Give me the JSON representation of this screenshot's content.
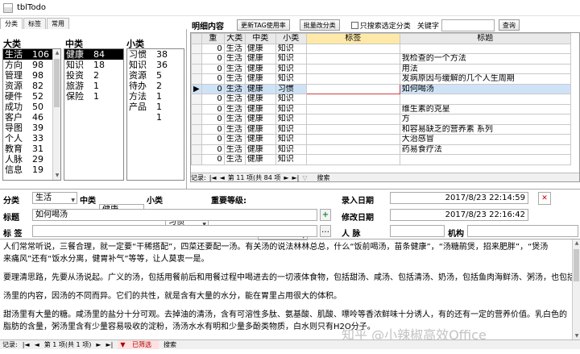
{
  "window": {
    "title": "tblTodo"
  },
  "tabs": [
    "分类",
    "标签",
    "常用"
  ],
  "left_pane": {
    "headers": {
      "big": "大类",
      "mid": "中类",
      "small": "小类"
    },
    "big": [
      {
        "name": "生活",
        "count": "106"
      },
      {
        "name": "方向",
        "count": "98"
      },
      {
        "name": "管理",
        "count": "98"
      },
      {
        "name": "资源",
        "count": "82"
      },
      {
        "name": "硬件",
        "count": "52"
      },
      {
        "name": "成功",
        "count": "50"
      },
      {
        "name": "客户",
        "count": "46"
      },
      {
        "name": "导图",
        "count": "39"
      },
      {
        "name": "个人",
        "count": "33"
      },
      {
        "name": "教育",
        "count": "31"
      },
      {
        "name": "人脉",
        "count": "29"
      },
      {
        "name": "信息",
        "count": "19"
      }
    ],
    "mid": [
      {
        "name": "健康",
        "count": "84"
      },
      {
        "name": "知识",
        "count": "18"
      },
      {
        "name": "投资",
        "count": "2"
      },
      {
        "name": "旅游",
        "count": "1"
      },
      {
        "name": "保险",
        "count": "1"
      }
    ],
    "small": [
      {
        "name": "习惯",
        "count": "38"
      },
      {
        "name": "知识",
        "count": "36"
      },
      {
        "name": "资源",
        "count": "5"
      },
      {
        "name": "待办",
        "count": "2"
      },
      {
        "name": "方法",
        "count": "1"
      },
      {
        "name": "产品",
        "count": "1"
      },
      {
        "name": "",
        "count": "1"
      }
    ]
  },
  "right_pane": {
    "label": "明细内容",
    "btn_update_tag": "更新TAG使用率",
    "btn_batch": "批量改分类",
    "chk_only_selected": "只搜索选定分类",
    "keyword_label": "关键字",
    "btn_search": "查询",
    "columns": [
      "重",
      "大类",
      "中类",
      "小类",
      "标签",
      "标题"
    ],
    "rows": [
      {
        "w": "0",
        "big": "生活",
        "mid": "健康",
        "small": "知识",
        "tag": "",
        "title": ""
      },
      {
        "w": "0",
        "big": "生活",
        "mid": "健康",
        "small": "知识",
        "tag": "",
        "title": "我检查的一个方法"
      },
      {
        "w": "0",
        "big": "生活",
        "mid": "健康",
        "small": "知识",
        "tag": "",
        "title": "用法"
      },
      {
        "w": "0",
        "big": "生活",
        "mid": "健康",
        "small": "知识",
        "tag": "",
        "title": "发病原因与缓解的几个人生周期"
      },
      {
        "w": "0",
        "big": "生活",
        "mid": "健康",
        "small": "习惯",
        "tag": "",
        "title": "如何喝汤"
      },
      {
        "w": "0",
        "big": "生活",
        "mid": "健康",
        "small": "知识",
        "tag": "",
        "title": ""
      },
      {
        "w": "0",
        "big": "生活",
        "mid": "健康",
        "small": "知识",
        "tag": "",
        "title": "维生素的克星"
      },
      {
        "w": "0",
        "big": "生活",
        "mid": "健康",
        "small": "知识",
        "tag": "",
        "title": "方"
      },
      {
        "w": "0",
        "big": "生活",
        "mid": "健康",
        "small": "知识",
        "tag": "",
        "title": "和容易缺乏的营养素 系列"
      },
      {
        "w": "0",
        "big": "生活",
        "mid": "健康",
        "small": "知识",
        "tag": "",
        "title": "大治感冒"
      },
      {
        "w": "0",
        "big": "生活",
        "mid": "健康",
        "small": "知识",
        "tag": "",
        "title": "药易食疗法"
      },
      {
        "w": "0",
        "big": "生活",
        "mid": "健康",
        "small": "知识",
        "tag": "",
        "title": ""
      }
    ],
    "nav": {
      "prefix": "记录:",
      "pos": "第 11 项(共 84 项",
      "search": "搜索"
    }
  },
  "form": {
    "lbl_big": "分类",
    "val_big": "生活",
    "lbl_mid": "中类",
    "val_mid": "健康",
    "lbl_small": "小类",
    "val_small": "习惯",
    "lbl_weight": "重要等级:",
    "val_weight": "0",
    "lbl_entry": "录入日期",
    "val_entry": "2017/8/23 22:14:59",
    "lbl_title": "标题",
    "val_title": "如何喝汤",
    "lbl_modify": "修改日期",
    "val_modify": "2017/8/23 22:16:42",
    "lbl_tag": "标 签",
    "lbl_contact": "人 脉",
    "lbl_org": "机构"
  },
  "content": {
    "p1": "人们常常听说，三餐合理，就一定要“干稀搭配”，四菜还要配一汤。有关汤的说法林林总总，什么“饭前喝汤，苗条健康”，“汤糖鹃煲，招来肥胖”，“煲汤",
    "p1b": "来痛风”还有“饭水分离，健胃补气”等等，让人莫衷一是。",
    "p2": "要理清思路，先要从汤说起。广义的汤，包括用餐前后和用餐过程中喝进去的一切液体食物，包括甜汤、咸汤、包括清汤、奶汤，包括鱼肉海鲜汤、粥汤，也包括",
    "p3": "汤里的内容，因汤的不同而异。它们的共性，就是含有大量的水分，能在胃里占用很大的体积。",
    "p4": "甜汤里有大量的糖。咸汤里的盐分十分可观。去掉油的清汤，含有可溶性多肽、氨基酸、肌酸、嘌呤等香浓鲜味十分诱人，有的还有一定的营养价值。乳白色的",
    "p4b": "脂肪的含量，粥汤里含有少量容易吸收的淀粉，汤汤水水有明和少量多酚类物质，白水则只有H2O分子。"
  },
  "bottom_nav": {
    "prefix": "记录:",
    "pos": "第 1 项(共 1 项)",
    "filter": "已筛选",
    "search": "搜索"
  },
  "watermark": "知乎 @小辣椒高效Office"
}
